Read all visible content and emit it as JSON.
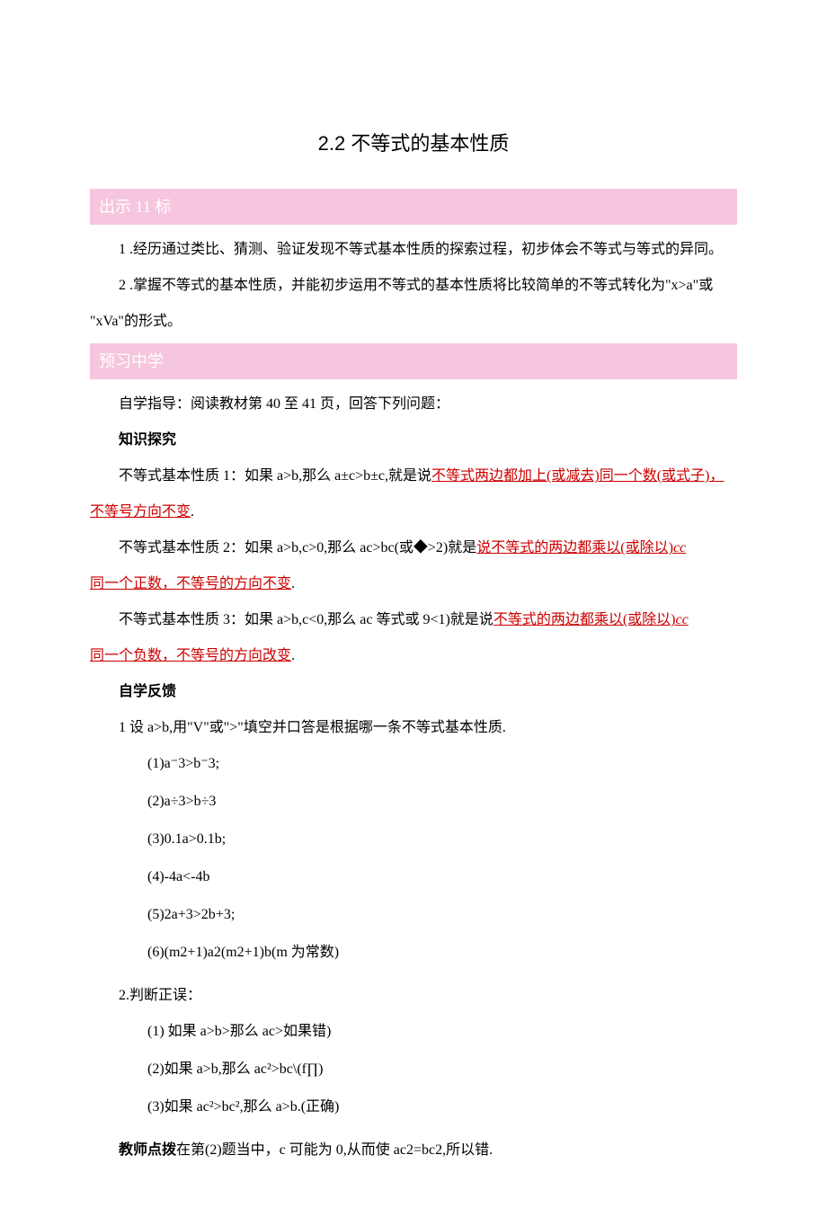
{
  "title": "2.2 不等式的基本性质",
  "section1": {
    "header": "出示 11 标",
    "p1": "1 .经历通过类比、猜测、验证发现不等式基本性质的探索过程，初步体会不等式与等式的异同。",
    "p2_a": "2 .掌握不等式的基本性质，并能初步运用不等式的基本性质将比较简单的不等式转化为\"x>a\"或",
    "p2_b": "\"xVa\"的形式。"
  },
  "section2": {
    "header": "预习中学",
    "guide": "自学指导：阅读教材第 40 至 41 页，回答下列问题：",
    "knowledge_title": "知识探究",
    "prop1_a": "不等式基本性质 1：如果 a>b,那么 a±c>b±c,就是说",
    "prop1_b": "不等式两边都加上(或减去)同一个数(或式子)，",
    "prop1_c": "不等号方向不变",
    "prop1_d": ".",
    "prop2_a": "不等式基本性质 2：如果 a>b,c>0,那么 ac>bc(或◆>2)就是",
    "prop2_b": "说不等式的两边都乘以(或除以)",
    "prop2_c": "cc",
    "prop2_d": "同一个正数，不等号的方向不变",
    "prop2_e": ".",
    "prop3_a": "不等式基本性质 3：如果 a>b,c<0,那么 ac 等式或 9<1)就是说",
    "prop3_b": "不等式的两边都乘以(或除以)",
    "prop3_c": "cc",
    "prop3_d": "同一个负数，不等号的方向改变",
    "prop3_e": ".",
    "feedback_title": "自学反馈",
    "q1_intro": "1 设 a>b,用\"V\"或\">\"填空并口答是根据哪一条不等式基本性质.",
    "q1_1": "(1)a⁻3>b⁻3;",
    "q1_2": "(2)a÷3>b÷3",
    "q1_3": "(3)0.1a>0.1b;",
    "q1_4": "(4)-4a<-4b",
    "q1_5": "(5)2a+3>2b+3;",
    "q1_6": "(6)(m2+1)a2(m2+1)b(m 为常数)",
    "q2_intro": "2.判断正误：",
    "q2_1": "(1) 如果 a>b>那么 ac>如果错)",
    "q2_2": "(2)如果 a>b,那么 ac²>bc\\(f∏)",
    "q2_3": "(3)如果 ac²>bc²,那么 a>b.(正确)",
    "teacher_label": "教师点拨",
    "teacher_text": "在第(2)题当中，c 可能为 0,从而使 ac2=bc2,所以错."
  }
}
